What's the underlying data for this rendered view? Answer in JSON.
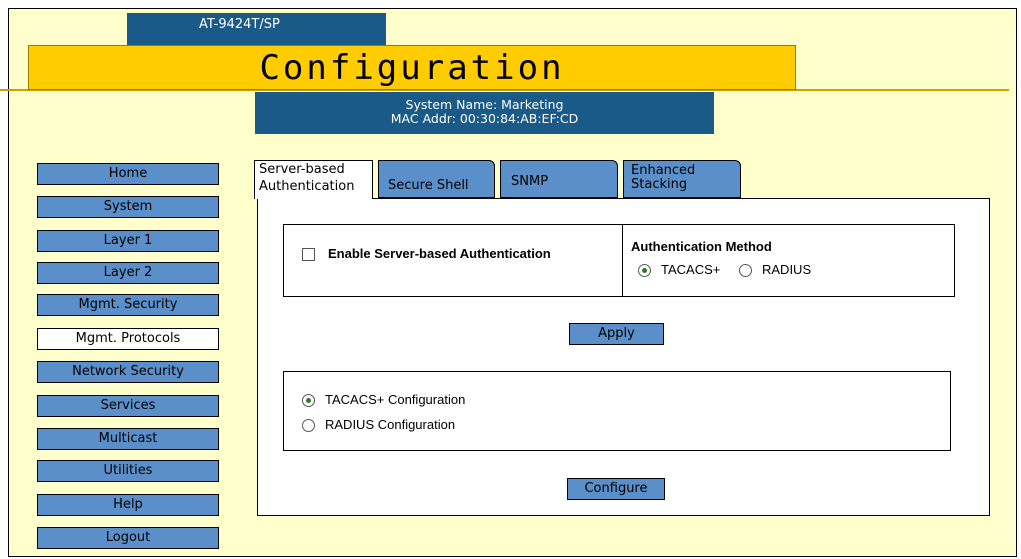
{
  "header": {
    "model": "AT-9424T/SP",
    "title": "Configuration",
    "system_name": "System Name: Marketing",
    "mac_addr": "MAC Addr: 00:30:84:AB:EF:CD"
  },
  "sidebar": {
    "items": [
      {
        "label": "Home"
      },
      {
        "label": "System"
      },
      {
        "label": "Layer 1"
      },
      {
        "label": "Layer 2"
      },
      {
        "label": "Mgmt. Security"
      },
      {
        "label": "Mgmt. Protocols",
        "active": true
      },
      {
        "label": "Network Security"
      },
      {
        "label": "Services"
      },
      {
        "label": "Multicast"
      },
      {
        "label": "Utilities"
      },
      {
        "label": "Help"
      },
      {
        "label": "Logout"
      }
    ]
  },
  "tabs": {
    "server_auth_line1": "Server-based",
    "server_auth_line2": "Authentication",
    "ssh": "Secure Shell",
    "snmp": "SNMP",
    "stacking_line1": "Enhanced",
    "stacking_line2": "Stacking"
  },
  "auth": {
    "enable_label": "Enable Server-based Authentication",
    "enable_checked": false,
    "method_title": "Authentication Method",
    "tacacs_label": "TACACS+",
    "radius_label": "RADIUS",
    "selected_method": "TACACS+"
  },
  "apply_label": "Apply",
  "config": {
    "tacacs_config_label": "TACACS+ Configuration",
    "radius_config_label": "RADIUS Configuration",
    "selected": "TACACS+ Configuration"
  },
  "configure_label": "Configure",
  "colors": {
    "background": "#ffffcc",
    "title_yellow": "#ffcc00",
    "header_blue": "#1a5a88",
    "nav_blue": "#5b8fc9"
  }
}
